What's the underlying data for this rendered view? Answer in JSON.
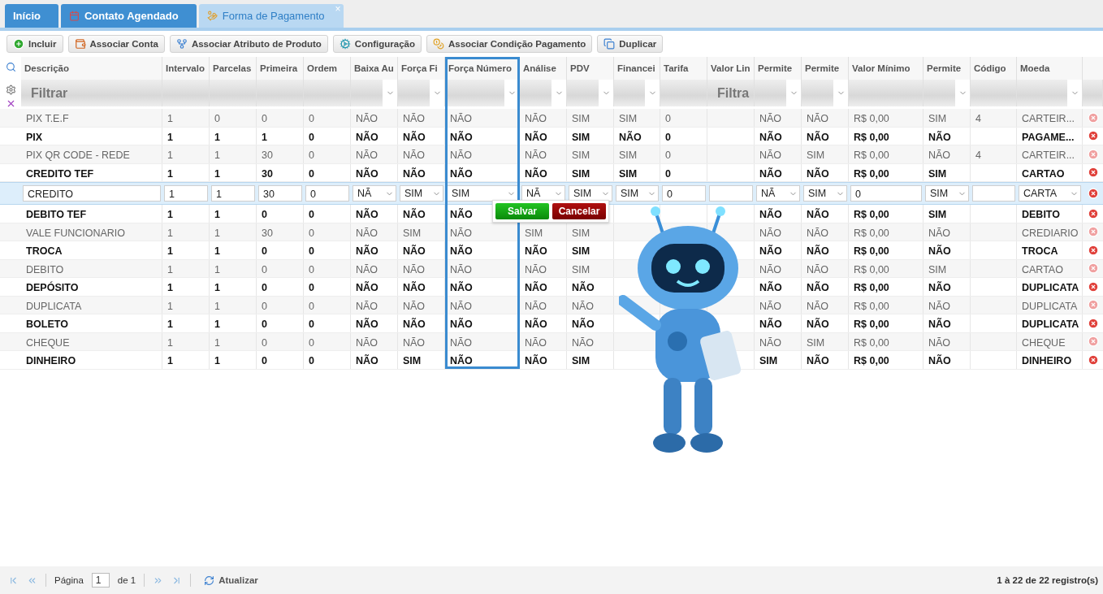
{
  "tabs": [
    {
      "label": "Início",
      "selected": false
    },
    {
      "label": "Contato Agendado",
      "selected": false
    },
    {
      "label": "Forma de Pagamento",
      "selected": true,
      "close": "×"
    }
  ],
  "toolbar": [
    {
      "label": "Incluir"
    },
    {
      "label": "Associar Conta"
    },
    {
      "label": "Associar Atributo de Produto"
    },
    {
      "label": "Configuração"
    },
    {
      "label": "Associar Condição Pagamento"
    },
    {
      "label": "Duplicar"
    }
  ],
  "columns": [
    {
      "label": "Descrição",
      "kind": "text",
      "placeholder": "Filtrar"
    },
    {
      "label": "Intervalo",
      "kind": "plain"
    },
    {
      "label": "Parcelas",
      "kind": "plain"
    },
    {
      "label": "Primeira",
      "kind": "plain"
    },
    {
      "label": "Ordem",
      "kind": "plain"
    },
    {
      "label": "Baixa Au",
      "kind": "select"
    },
    {
      "label": "Força Fi",
      "kind": "select"
    },
    {
      "label": "Força Número",
      "kind": "select"
    },
    {
      "label": "Análise",
      "kind": "select"
    },
    {
      "label": "PDV",
      "kind": "select"
    },
    {
      "label": "Financei",
      "kind": "select"
    },
    {
      "label": "Tarifa",
      "kind": "plain"
    },
    {
      "label": "Valor Lin",
      "kind": "text",
      "placeholder": "Filtra"
    },
    {
      "label": "Permite",
      "kind": "select"
    },
    {
      "label": "Permite",
      "kind": "select"
    },
    {
      "label": "Valor Mínimo",
      "kind": "plain"
    },
    {
      "label": "Permite",
      "kind": "select"
    },
    {
      "label": "Código",
      "kind": "plain"
    },
    {
      "label": "Moeda",
      "kind": "select"
    }
  ],
  "rows_before": [
    {
      "active": false,
      "cells": [
        "PIX T.E.F",
        "1",
        "0",
        "0",
        "0",
        "NÃO",
        "NÃO",
        "NÃO",
        "NÃO",
        "SIM",
        "SIM",
        "0",
        null,
        "NÃO",
        "NÃO",
        "R$ 0,00",
        "SIM",
        "4",
        "CARTEIR..."
      ]
    },
    {
      "active": true,
      "cells": [
        "PIX",
        "1",
        "1",
        "1",
        "0",
        "NÃO",
        "NÃO",
        "NÃO",
        "NÃO",
        "SIM",
        "NÃO",
        "0",
        null,
        "NÃO",
        "NÃO",
        "R$ 0,00",
        "NÃO",
        null,
        "PAGAME..."
      ]
    },
    {
      "active": false,
      "cells": [
        "PIX QR CODE - REDE",
        "1",
        "1",
        "30",
        "0",
        "NÃO",
        "NÃO",
        "NÃO",
        "NÃO",
        "SIM",
        "SIM",
        "0",
        null,
        "NÃO",
        "SIM",
        "R$ 0,00",
        "NÃO",
        "4",
        "CARTEIR..."
      ]
    },
    {
      "active": true,
      "cells": [
        "CREDITO TEF",
        "1",
        "1",
        "30",
        "0",
        "NÃO",
        "NÃO",
        "NÃO",
        "NÃO",
        "SIM",
        "SIM",
        "0",
        null,
        "NÃO",
        "NÃO",
        "R$ 0,00",
        "SIM",
        null,
        "CARTAO"
      ]
    }
  ],
  "editing_row": [
    {
      "kind": "text",
      "value": "CREDITO"
    },
    {
      "kind": "text",
      "value": "1"
    },
    {
      "kind": "text",
      "value": "1"
    },
    {
      "kind": "text",
      "value": "30"
    },
    {
      "kind": "text",
      "value": "0"
    },
    {
      "kind": "select",
      "value": "NÃ"
    },
    {
      "kind": "select",
      "value": "SIM"
    },
    {
      "kind": "select",
      "value": "SIM"
    },
    {
      "kind": "select",
      "value": "NÃ"
    },
    {
      "kind": "select",
      "value": "SIM"
    },
    {
      "kind": "select",
      "value": "SIM"
    },
    {
      "kind": "text",
      "value": "0"
    },
    {
      "kind": "text"
    },
    {
      "kind": "select",
      "value": "NÃ"
    },
    {
      "kind": "select",
      "value": "SIM"
    },
    {
      "kind": "text",
      "value": "0"
    },
    {
      "kind": "select",
      "value": "SIM"
    },
    {
      "kind": "text"
    },
    {
      "kind": "select",
      "value": "CARTA"
    }
  ],
  "edit_actions": [
    {
      "label": "Salvar",
      "kind": "save"
    },
    {
      "label": "Cancelar",
      "kind": "cancel"
    }
  ],
  "rows_after": [
    {
      "active": true,
      "cells": [
        "DEBITO TEF",
        "1",
        "1",
        "0",
        "0",
        "NÃO",
        "NÃO",
        "NÃO",
        null,
        null,
        null,
        null,
        null,
        "NÃO",
        "NÃO",
        "R$ 0,00",
        "SIM",
        null,
        "DEBITO"
      ]
    },
    {
      "active": false,
      "cells": [
        "VALE FUNCIONARIO",
        "1",
        "1",
        "30",
        "0",
        "NÃO",
        "SIM",
        "NÃO",
        "SIM",
        "SIM",
        null,
        null,
        null,
        "NÃO",
        "NÃO",
        "R$ 0,00",
        "NÃO",
        null,
        "CREDIARIO"
      ]
    },
    {
      "active": true,
      "cells": [
        "TROCA",
        "1",
        "1",
        "0",
        "0",
        "NÃO",
        "NÃO",
        "NÃO",
        "NÃO",
        "SIM",
        null,
        null,
        null,
        "NÃO",
        "NÃO",
        "R$ 0,00",
        "NÃO",
        null,
        "TROCA"
      ]
    },
    {
      "active": false,
      "cells": [
        "DEBITO",
        "1",
        "1",
        "0",
        "0",
        "NÃO",
        "NÃO",
        "NÃO",
        "NÃO",
        "SIM",
        null,
        null,
        null,
        "NÃO",
        "NÃO",
        "R$ 0,00",
        "SIM",
        null,
        "CARTAO"
      ]
    },
    {
      "active": true,
      "cells": [
        "DEPÓSITO",
        "1",
        "1",
        "0",
        "0",
        "NÃO",
        "NÃO",
        "NÃO",
        "NÃO",
        "NÃO",
        null,
        null,
        null,
        "NÃO",
        "NÃO",
        "R$ 0,00",
        "NÃO",
        null,
        "DUPLICATA"
      ]
    },
    {
      "active": false,
      "cells": [
        "DUPLICATA",
        "1",
        "1",
        "0",
        "0",
        "NÃO",
        "NÃO",
        "NÃO",
        "NÃO",
        "NÃO",
        null,
        null,
        null,
        "NÃO",
        "NÃO",
        "R$ 0,00",
        "NÃO",
        null,
        "DUPLICATA"
      ]
    },
    {
      "active": true,
      "cells": [
        "BOLETO",
        "1",
        "1",
        "0",
        "0",
        "NÃO",
        "NÃO",
        "NÃO",
        "NÃO",
        "NÃO",
        null,
        null,
        null,
        "NÃO",
        "NÃO",
        "R$ 0,00",
        "NÃO",
        null,
        "DUPLICATA"
      ]
    },
    {
      "active": false,
      "cells": [
        "CHEQUE",
        "1",
        "1",
        "0",
        "0",
        "NÃO",
        "NÃO",
        "NÃO",
        "NÃO",
        "NÃO",
        null,
        null,
        null,
        "NÃO",
        "SIM",
        "R$ 0,00",
        "NÃO",
        null,
        "CHEQUE"
      ]
    },
    {
      "active": true,
      "cells": [
        "DINHEIRO",
        "1",
        "1",
        "0",
        "0",
        "NÃO",
        "SIM",
        "NÃO",
        "NÃO",
        "SIM",
        null,
        null,
        null,
        "SIM",
        "NÃO",
        "R$ 0,00",
        "NÃO",
        null,
        "DINHEIRO"
      ]
    }
  ],
  "pager": {
    "page_label": "Página",
    "page": "1",
    "of": "de 1",
    "refresh": "Atualizar",
    "summary": "1 à 22 de 22 registro(s)"
  }
}
